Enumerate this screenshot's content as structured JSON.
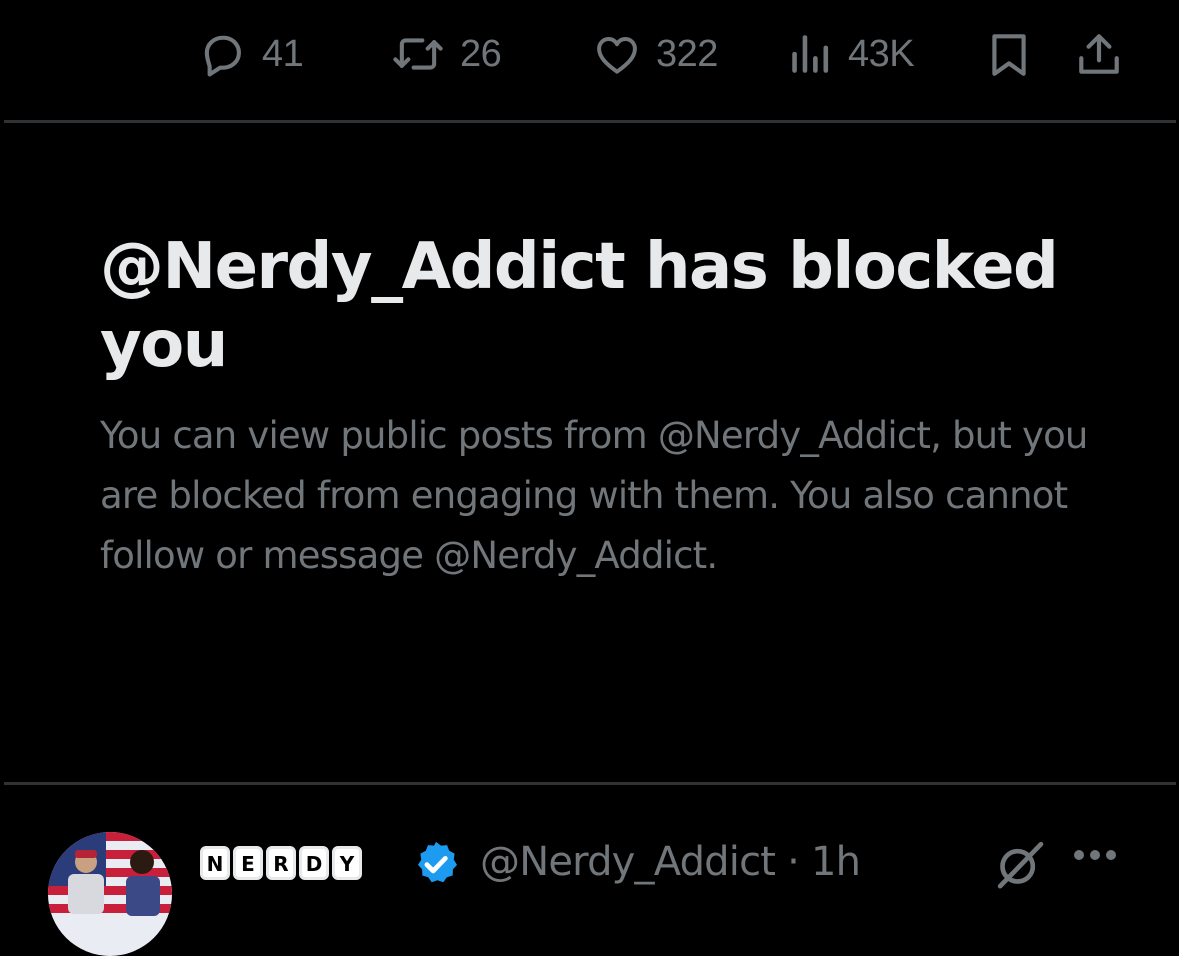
{
  "actions": {
    "replies": "41",
    "reposts": "26",
    "likes": "322",
    "views": "43K"
  },
  "blocked_notice": {
    "title": "@Nerdy_Addict has blocked you",
    "body": "You can view public posts from @Nerdy_Addict, but you are blocked from engaging with them. You also cannot follow or message @Nerdy_Addict."
  },
  "next_post": {
    "name_letters": [
      "N",
      "E",
      "R",
      "D",
      "Y"
    ],
    "handle": "@Nerdy_Addict",
    "separator": "·",
    "time": "1h"
  },
  "colors": {
    "background": "#000000",
    "primary_text": "#e7e9ea",
    "secondary_text": "#71767b",
    "divider": "#2f3336",
    "verified": "#1d9bf0"
  },
  "icons": [
    "reply-icon",
    "repost-icon",
    "like-icon",
    "views-icon",
    "bookmark-icon",
    "share-icon",
    "verified-badge-icon",
    "grok-icon",
    "more-icon"
  ]
}
